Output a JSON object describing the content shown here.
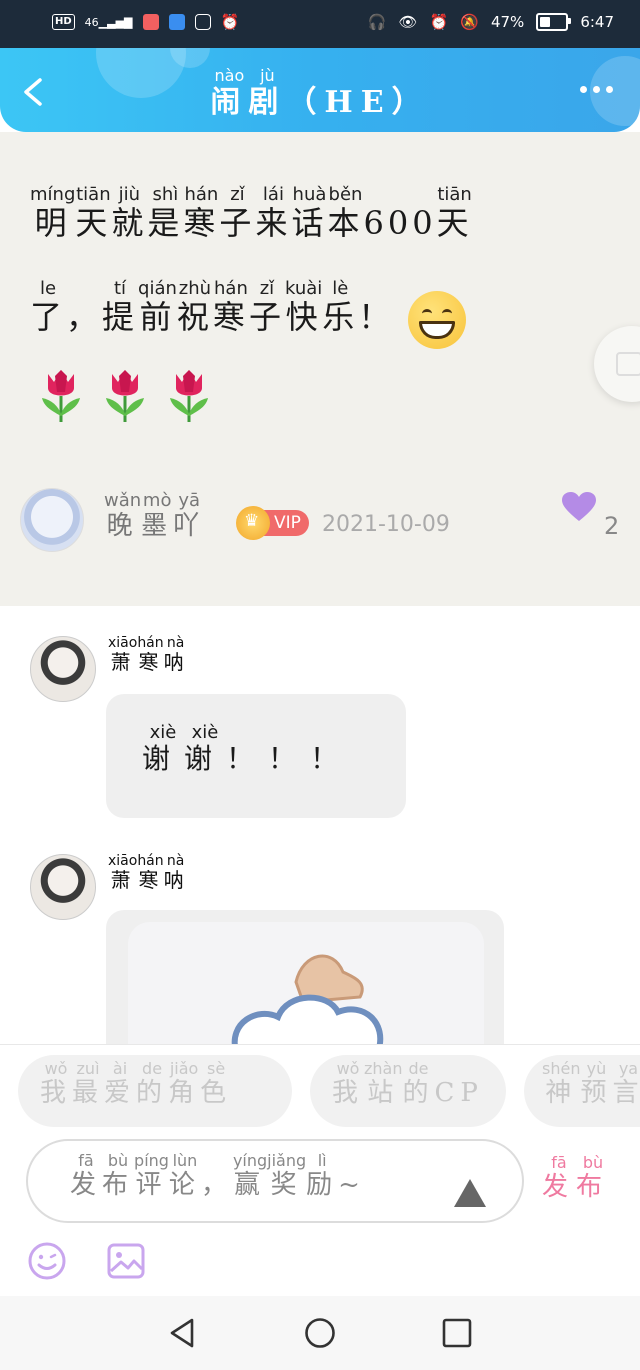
{
  "status_bar": {
    "left_icons": [
      "hd-icon",
      "signal-icon",
      "app-notification-icon",
      "app-notification-icon",
      "app-notification-icon",
      "alarm-icon"
    ],
    "hd_label": "HD",
    "signal_label": "46",
    "battery_percent": "47%",
    "battery_level": 0.47,
    "time": "6:47"
  },
  "header": {
    "title_chars": [
      {
        "char": "闹",
        "pinyin": "nào"
      },
      {
        "char": "剧",
        "pinyin": "jù"
      }
    ],
    "title_suffix": "（HE）"
  },
  "post": {
    "line1": [
      {
        "char": "明",
        "pinyin": "míng"
      },
      {
        "char": "天",
        "pinyin": "tiān"
      },
      {
        "char": "就",
        "pinyin": "jiù"
      },
      {
        "char": "是",
        "pinyin": "shì"
      },
      {
        "char": "寒",
        "pinyin": "hán"
      },
      {
        "char": "子",
        "pinyin": "zǐ"
      },
      {
        "char": "来",
        "pinyin": "lái"
      },
      {
        "char": "话",
        "pinyin": "huà"
      },
      {
        "char": "本",
        "pinyin": "běn"
      },
      {
        "char": "600",
        "pinyin": ""
      },
      {
        "char": "天",
        "pinyin": "tiān"
      }
    ],
    "line2": [
      {
        "char": "了",
        "pinyin": "le"
      },
      {
        "char": "，",
        "pinyin": ""
      },
      {
        "char": "提",
        "pinyin": "tí"
      },
      {
        "char": "前",
        "pinyin": "qián"
      },
      {
        "char": "祝",
        "pinyin": "zhù"
      },
      {
        "char": "寒",
        "pinyin": "hán"
      },
      {
        "char": "子",
        "pinyin": "zǐ"
      },
      {
        "char": "快",
        "pinyin": "kuài"
      },
      {
        "char": "乐",
        "pinyin": "lè"
      },
      {
        "char": "！",
        "pinyin": ""
      }
    ],
    "tulip_count": 3,
    "author": {
      "name_chars": [
        {
          "char": "晚",
          "pinyin": "wǎn"
        },
        {
          "char": "墨",
          "pinyin": "mò"
        },
        {
          "char": "吖",
          "pinyin": "yā"
        }
      ],
      "vip_label": "VIP"
    },
    "date": "2021-10-09",
    "likes": "2",
    "like_color": "#b48be6"
  },
  "comments": [
    {
      "name_chars": [
        {
          "char": "萧",
          "pinyin": "xiāo"
        },
        {
          "char": "寒",
          "pinyin": "hán"
        },
        {
          "char": "呐",
          "pinyin": "nà"
        }
      ],
      "text_chars": [
        {
          "char": "谢",
          "pinyin": "xiè"
        },
        {
          "char": "谢",
          "pinyin": "xiè"
        },
        {
          "char": "！",
          "pinyin": ""
        },
        {
          "char": "！",
          "pinyin": ""
        },
        {
          "char": "！",
          "pinyin": ""
        }
      ]
    },
    {
      "name_chars": [
        {
          "char": "萧",
          "pinyin": "xiāo"
        },
        {
          "char": "寒",
          "pinyin": "hán"
        },
        {
          "char": "呐",
          "pinyin": "nà"
        }
      ],
      "image": "cartoon-sticker-image"
    }
  ],
  "bottom": {
    "topics": [
      [
        {
          "char": "我",
          "pinyin": "wǒ"
        },
        {
          "char": "最",
          "pinyin": "zuì"
        },
        {
          "char": "爱",
          "pinyin": "ài"
        },
        {
          "char": "的",
          "pinyin": "de"
        },
        {
          "char": "角",
          "pinyin": "jiǎo"
        },
        {
          "char": "色",
          "pinyin": "sè"
        }
      ],
      [
        {
          "char": "我",
          "pinyin": "wǒ"
        },
        {
          "char": "站",
          "pinyin": "zhàn"
        },
        {
          "char": "的",
          "pinyin": "de"
        },
        {
          "char": "CP",
          "pinyin": ""
        }
      ],
      [
        {
          "char": "神",
          "pinyin": "shén"
        },
        {
          "char": "预",
          "pinyin": "yù"
        },
        {
          "char": "言",
          "pinyin": "ya"
        }
      ]
    ],
    "input_placeholder": [
      {
        "char": "发",
        "pinyin": "fā"
      },
      {
        "char": "布",
        "pinyin": "bù"
      },
      {
        "char": "评",
        "pinyin": "píng"
      },
      {
        "char": "论",
        "pinyin": "lùn"
      },
      {
        "char": "，",
        "pinyin": ""
      },
      {
        "char": "赢",
        "pinyin": "yíng"
      },
      {
        "char": "奖",
        "pinyin": "jiǎng"
      },
      {
        "char": "励",
        "pinyin": "lì"
      },
      {
        "char": "~",
        "pinyin": ""
      }
    ],
    "publish_chars": [
      {
        "char": "发",
        "pinyin": "fā"
      },
      {
        "char": "布",
        "pinyin": "bù"
      }
    ],
    "accent_color": "#ef7aa0",
    "tool_icon_color": "#c9a6ee"
  },
  "nav": {
    "buttons": [
      "back-triangle-icon",
      "home-circle-icon",
      "recents-square-icon"
    ]
  }
}
